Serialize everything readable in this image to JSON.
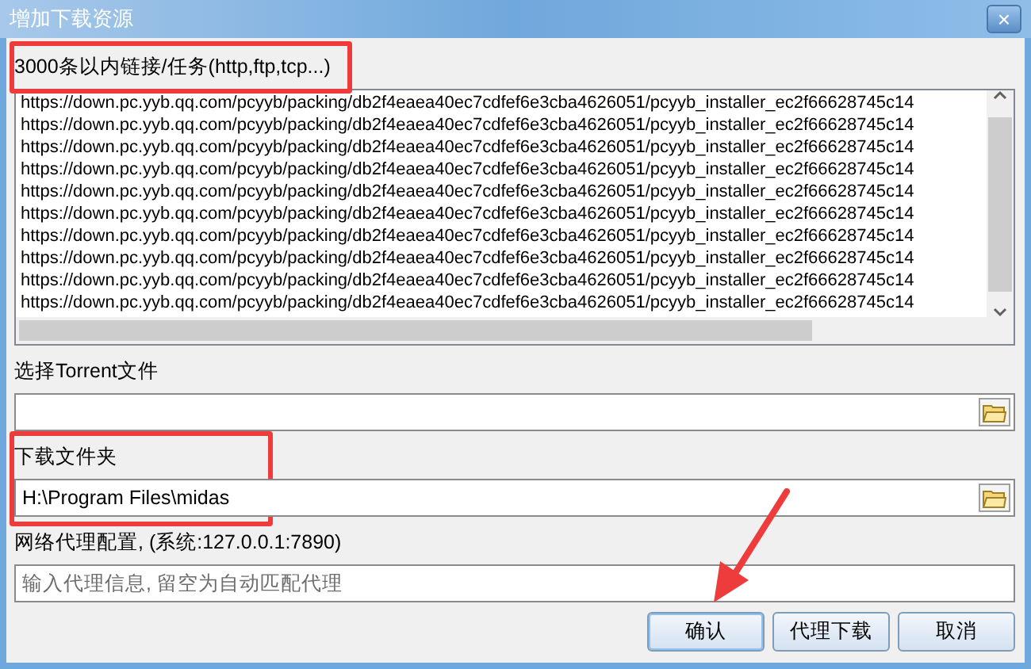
{
  "window": {
    "title": "增加下载资源",
    "close": "×"
  },
  "links": {
    "label": "3000条以内链接/任务(http,ftp,tcp...)",
    "highlighted": true,
    "lines": [
      "https://down.pc.yyb.qq.com/pcyyb/packing/db2f4eaea40ec7cdfef6e3cba4626051/pcyyb_installer_ec2f66628745c14",
      "https://down.pc.yyb.qq.com/pcyyb/packing/db2f4eaea40ec7cdfef6e3cba4626051/pcyyb_installer_ec2f66628745c14",
      "https://down.pc.yyb.qq.com/pcyyb/packing/db2f4eaea40ec7cdfef6e3cba4626051/pcyyb_installer_ec2f66628745c14",
      "https://down.pc.yyb.qq.com/pcyyb/packing/db2f4eaea40ec7cdfef6e3cba4626051/pcyyb_installer_ec2f66628745c14",
      "https://down.pc.yyb.qq.com/pcyyb/packing/db2f4eaea40ec7cdfef6e3cba4626051/pcyyb_installer_ec2f66628745c14",
      "https://down.pc.yyb.qq.com/pcyyb/packing/db2f4eaea40ec7cdfef6e3cba4626051/pcyyb_installer_ec2f66628745c14",
      "https://down.pc.yyb.qq.com/pcyyb/packing/db2f4eaea40ec7cdfef6e3cba4626051/pcyyb_installer_ec2f66628745c14",
      "https://down.pc.yyb.qq.com/pcyyb/packing/db2f4eaea40ec7cdfef6e3cba4626051/pcyyb_installer_ec2f66628745c14",
      "https://down.pc.yyb.qq.com/pcyyb/packing/db2f4eaea40ec7cdfef6e3cba4626051/pcyyb_installer_ec2f66628745c14",
      "https://down.pc.yyb.qq.com/pcyyb/packing/db2f4eaea40ec7cdfef6e3cba4626051/pcyyb_installer_ec2f66628745c14"
    ]
  },
  "torrent": {
    "label": "选择Torrent文件"
  },
  "folder": {
    "label": "下载文件夹",
    "value": "H:\\Program Files\\midas",
    "highlighted": true
  },
  "proxy": {
    "label": "网络代理配置, (系统:127.0.0.1:7890)",
    "placeholder": "输入代理信息, 留空为自动匹配代理"
  },
  "buttons": [
    {
      "label": "确认",
      "pointed": true
    },
    {
      "label": "代理下载",
      "pointed": false
    },
    {
      "label": "取消",
      "pointed": false
    }
  ]
}
